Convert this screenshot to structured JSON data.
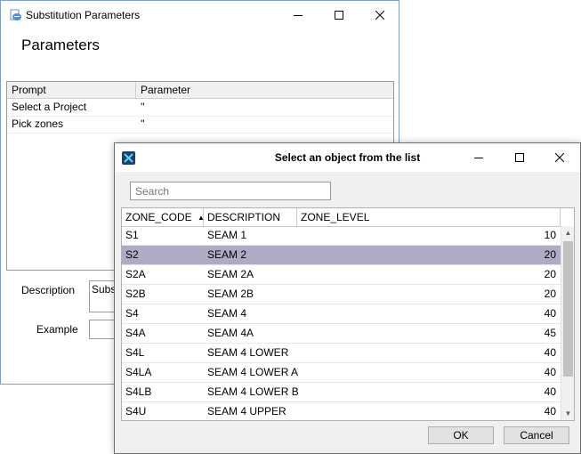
{
  "back_window": {
    "title": "Substitution Parameters",
    "heading": "Parameters",
    "grid": {
      "headers": [
        "Prompt",
        "Parameter"
      ],
      "rows": [
        {
          "prompt": "Select a Project",
          "parameter": "''"
        },
        {
          "prompt": "Pick zones",
          "parameter": "''"
        }
      ]
    },
    "description_label": "Description",
    "description_value": "Subst",
    "example_label": "Example",
    "example_value": ""
  },
  "dialog": {
    "title": "Select an object from the list",
    "search_placeholder": "Search",
    "columns": [
      "ZONE_CODE",
      "DESCRIPTION",
      "ZONE_LEVEL"
    ],
    "sort_indicator": "▲",
    "rows": [
      {
        "code": "S1",
        "description": "SEAM 1",
        "level": "10"
      },
      {
        "code": "S2",
        "description": "SEAM 2",
        "level": "20"
      },
      {
        "code": "S2A",
        "description": "SEAM 2A",
        "level": "20"
      },
      {
        "code": "S2B",
        "description": "SEAM 2B",
        "level": "20"
      },
      {
        "code": "S4",
        "description": "SEAM 4",
        "level": "40"
      },
      {
        "code": "S4A",
        "description": "SEAM 4A",
        "level": "45"
      },
      {
        "code": "S4L",
        "description": "SEAM 4 LOWER",
        "level": "40"
      },
      {
        "code": "S4LA",
        "description": "SEAM 4 LOWER A",
        "level": "40"
      },
      {
        "code": "S4LB",
        "description": "SEAM 4 LOWER B",
        "level": "40"
      },
      {
        "code": "S4U",
        "description": "SEAM 4 UPPER",
        "level": "40"
      }
    ],
    "selected_index": 1,
    "ok_label": "OK",
    "cancel_label": "Cancel"
  },
  "colors": {
    "selection": "#b0aac4",
    "window_border": "#7a9cc6"
  }
}
